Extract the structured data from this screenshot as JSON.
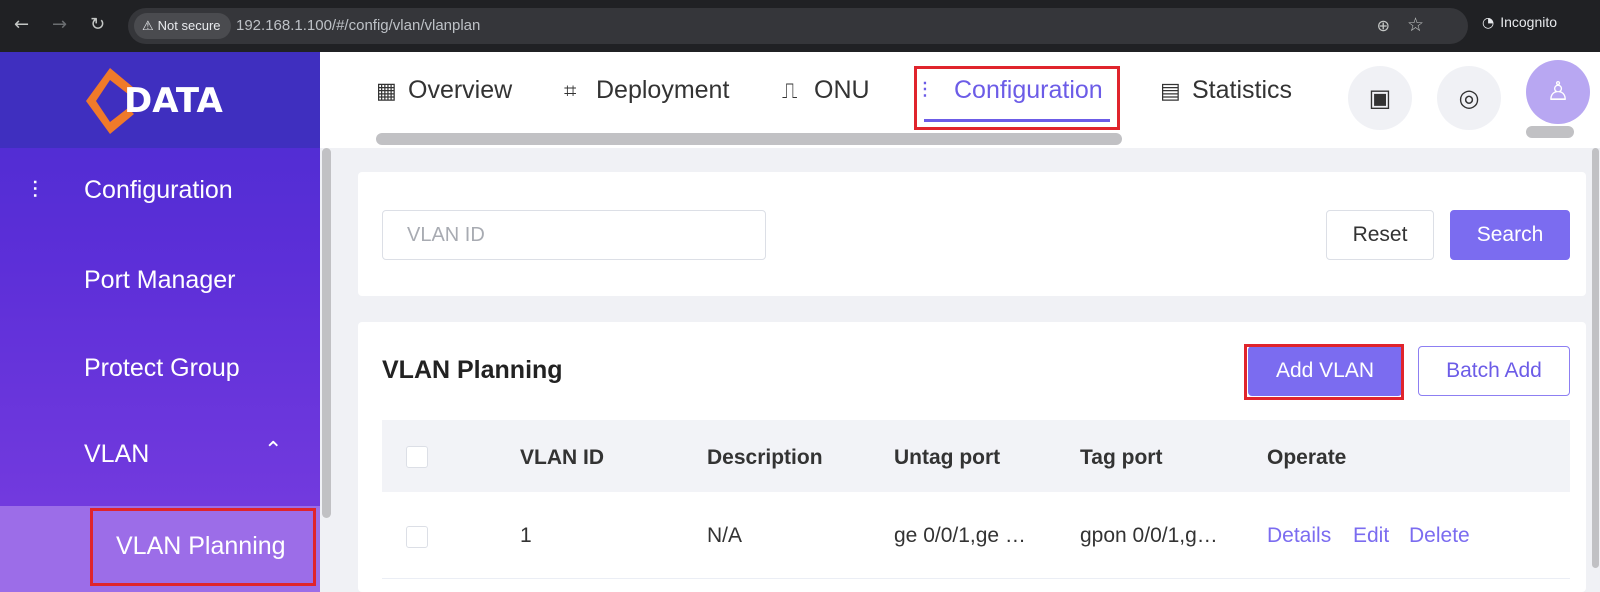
{
  "browser": {
    "security_label": "Not secure",
    "url": "192.168.1.100/#/config/vlan/vlanplan",
    "profile": "Incognito"
  },
  "brand": {
    "logo_text": "DATA",
    "accent_color": "#f07a2a"
  },
  "sidebar": {
    "section": "Configuration",
    "items": [
      {
        "label": "Port Manager"
      },
      {
        "label": "Protect Group"
      },
      {
        "label": "VLAN"
      }
    ],
    "active_item": "VLAN Planning"
  },
  "topnav": {
    "tabs": [
      {
        "label": "Overview",
        "icon": "grid-icon"
      },
      {
        "label": "Deployment",
        "icon": "deployment-icon"
      },
      {
        "label": "ONU",
        "icon": "router-icon"
      },
      {
        "label": "Configuration",
        "icon": "sliders-icon",
        "active": true
      },
      {
        "label": "Statistics",
        "icon": "browser-window-icon"
      }
    ]
  },
  "search": {
    "placeholder": "VLAN ID",
    "reset_label": "Reset",
    "search_label": "Search"
  },
  "panel": {
    "title": "VLAN Planning",
    "add_label": "Add VLAN",
    "batch_label": "Batch Add"
  },
  "table": {
    "columns": [
      "VLAN ID",
      "Description",
      "Untag port",
      "Tag port",
      "Operate"
    ],
    "rows": [
      {
        "vlan_id": "1",
        "description": "N/A",
        "untag_port": "ge 0/0/1,ge …",
        "tag_port": "gpon 0/0/1,g…",
        "actions": [
          "Details",
          "Edit",
          "Delete"
        ]
      }
    ]
  },
  "colors": {
    "primary": "#7b6cf0",
    "highlight": "#e0242c",
    "sidebar_top": "#4a2bd0"
  }
}
